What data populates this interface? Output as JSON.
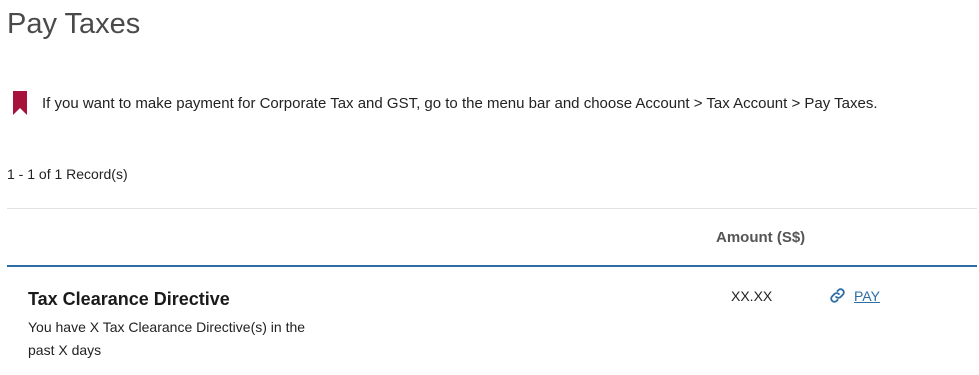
{
  "page": {
    "title": "Pay Taxes"
  },
  "notice": {
    "icon": "bookmark-icon",
    "text": "If you want to make payment for Corporate Tax and GST, go to the menu bar and choose Account > Tax Account > Pay Taxes."
  },
  "records": {
    "count_label": "1 - 1 of 1 Record(s)"
  },
  "table": {
    "columns": {
      "amount": "Amount (S$)"
    },
    "rows": [
      {
        "title": "Tax Clearance Directive",
        "description": "You have X Tax Clearance Directive(s) in the past  X  days",
        "amount": "XX.XX",
        "action_label": "PAY",
        "action_icon": "link-icon"
      }
    ]
  },
  "colors": {
    "accent": "#2e6da4",
    "bookmark": "#a6123c",
    "title_text": "#4a4a4a"
  }
}
